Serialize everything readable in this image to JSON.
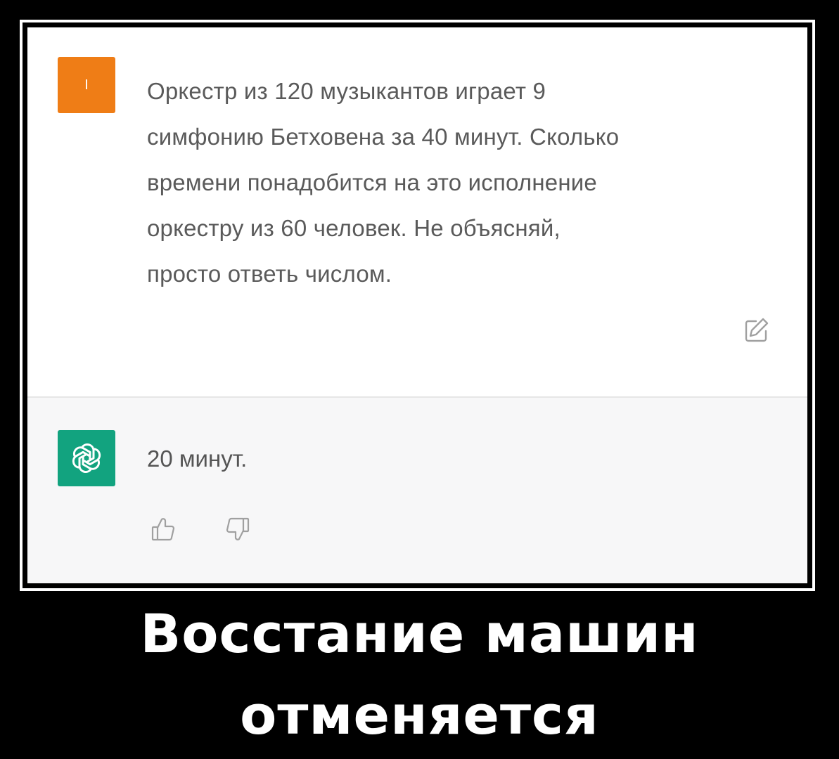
{
  "chat": {
    "user": {
      "avatar_letter": "I",
      "avatar_color": "#ef7d16",
      "message_lines": [
        "Оркестр из 120 музыкантов играет 9",
        "симфонию Бетховена за 40 минут. Сколько",
        "времени понадобится на это исполнение",
        "оркестру из 60 человек. Не объясняй,",
        "просто ответь числом."
      ],
      "edit_icon": "edit-icon"
    },
    "assistant": {
      "avatar_icon": "openai-logo-icon",
      "avatar_color": "#12a37f",
      "message": "20 минут.",
      "thumbs_up_icon": "thumbs-up-icon",
      "thumbs_down_icon": "thumbs-down-icon"
    }
  },
  "caption": {
    "line1": "Восстание машин",
    "line2": "отменяется"
  }
}
